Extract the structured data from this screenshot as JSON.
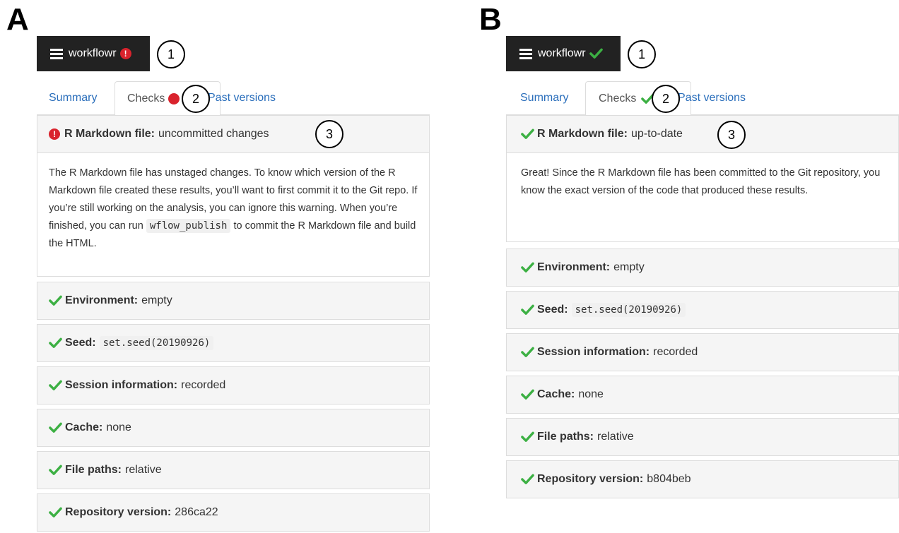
{
  "colors": {
    "check": "#3cb043",
    "error": "#d9232d",
    "link": "#2a6ebb",
    "button_bg": "#222222"
  },
  "icons": {
    "check": "check-icon",
    "error": "exclamation-circle-icon",
    "menu": "hamburger-list-icon"
  },
  "panels": [
    {
      "letter": "A",
      "button_label": "workflowr",
      "status": "error",
      "callouts": [
        "1",
        "2",
        "3"
      ],
      "tabs": {
        "summary": "Summary",
        "checks": "Checks",
        "past": "Past versions"
      },
      "first_check": {
        "title": "R Markdown file:",
        "value": "uncommitted changes"
      },
      "body": {
        "text_before": "The R Markdown file has unstaged changes. To know which version of the R Markdown file created these results, you’ll want to first commit it to the Git repo. If you’re still working on the analysis, you can ignore this warning. When you’re finished, you can run",
        "code": "wflow_publish",
        "text_after": "to commit the R Markdown file and build the HTML."
      },
      "checks": [
        {
          "title": "Environment:",
          "value": "empty"
        },
        {
          "title": "Seed:",
          "code": "set.seed(20190926)"
        },
        {
          "title": "Session information:",
          "value": "recorded"
        },
        {
          "title": "Cache:",
          "value": "none"
        },
        {
          "title": "File paths:",
          "value": "relative"
        },
        {
          "title": "Repository version:",
          "value": "286ca22"
        }
      ]
    },
    {
      "letter": "B",
      "button_label": "workflowr",
      "status": "ok",
      "callouts": [
        "1",
        "2",
        "3"
      ],
      "tabs": {
        "summary": "Summary",
        "checks": "Checks",
        "past": "Past versions"
      },
      "first_check": {
        "title": "R Markdown file:",
        "value": "up-to-date"
      },
      "body": {
        "text_before": "Great! Since the R Markdown file has been committed to the Git repository, you know the exact version of the code that produced these results."
      },
      "checks": [
        {
          "title": "Environment:",
          "value": "empty"
        },
        {
          "title": "Seed:",
          "code": "set.seed(20190926)"
        },
        {
          "title": "Session information:",
          "value": "recorded"
        },
        {
          "title": "Cache:",
          "value": "none"
        },
        {
          "title": "File paths:",
          "value": "relative"
        },
        {
          "title": "Repository version:",
          "value": "b804beb"
        }
      ]
    }
  ]
}
